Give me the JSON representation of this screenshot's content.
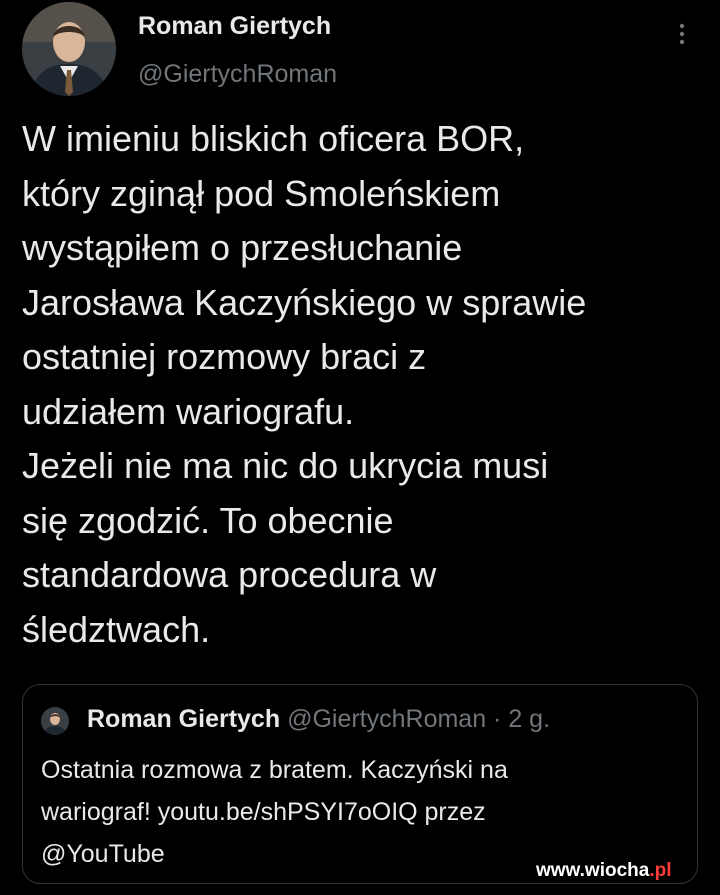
{
  "tweet": {
    "author_name": "Roman Giertych",
    "author_handle": "@GiertychRoman",
    "more_icon": "more-vertical-icon",
    "text": "W imieniu bliskich oficera BOR,\nktóry zginął pod Smoleńskiem\nwystąpiłem o przesłuchanie\nJarosława Kaczyńskiego w sprawie\nostatniej rozmowy braci z\nudziałem wariografu.\nJeżeli nie ma nic do ukrycia musi\nsię zgodzić. To obecnie\nstandardowa procedura w\nśledztwach."
  },
  "quoted": {
    "author_name": "Roman Giertych",
    "meta": "@GiertychRoman · 2 g.",
    "text": "Ostatnia rozmowa z bratem. Kaczyński na\nwariograf! youtu.be/shPSYI7oOIQ przez\n@YouTube"
  },
  "watermark": {
    "site": "www.wiocha",
    "tld": ".pl"
  },
  "colors": {
    "background": "#000000",
    "primary_text": "#e7e9ea",
    "secondary_text": "#71767b",
    "border": "#2f3336",
    "watermark_accent": "#ff3b3b"
  }
}
